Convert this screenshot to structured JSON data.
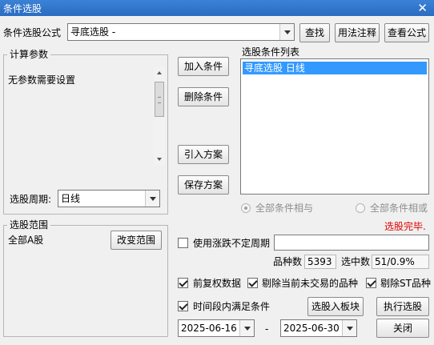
{
  "window": {
    "title": "条件选股",
    "close_glyph": "✕"
  },
  "formula": {
    "label": "条件选股公式",
    "value": "寻底选股     -",
    "find_button": "查找",
    "usage_button": "用法注释",
    "view_button": "查看公式"
  },
  "params": {
    "group_title": "计算参数",
    "text": "无参数需要设置",
    "period_label": "选股周期:",
    "period_value": "日线"
  },
  "actions": {
    "add": "加入条件",
    "delete": "删除条件",
    "import": "引入方案",
    "save": "保存方案"
  },
  "conditions": {
    "title": "选股条件列表",
    "items": [
      "寻底选股  日线"
    ],
    "radio_and": "全部条件相与",
    "radio_or": "全部条件相或",
    "status": "选股完毕."
  },
  "range": {
    "group_title": "选股范围",
    "value": "全部A股",
    "change_button": "改变范围"
  },
  "options": {
    "use_period_label": "使用涨跌不定周期",
    "count_label": "品种数",
    "count_value": "5393",
    "selected_label": "选中数",
    "selected_value": "51/0.9%",
    "adj_label": "前复权数据",
    "exclude_untraded_label": "剔除当前未交易的品种",
    "exclude_st_label": "剔除ST品种",
    "time_label": "时间段内满足条件"
  },
  "dates": {
    "start": "2025-06-16",
    "separator": "-",
    "end": "2025-06-30"
  },
  "bottom_buttons": {
    "to_block": "选股入板块",
    "execute": "执行选股",
    "close": "关闭"
  },
  "colors": {
    "status_red": "#e00000",
    "selection_blue": "#3399ff"
  }
}
